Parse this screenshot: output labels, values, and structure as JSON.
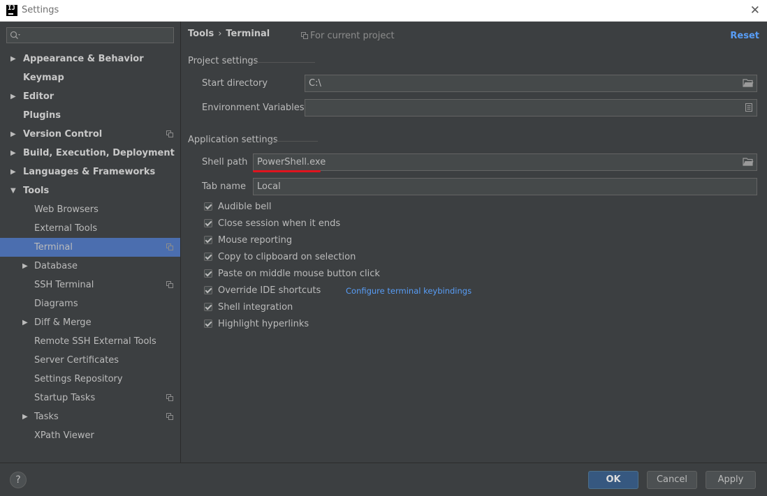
{
  "window": {
    "title": "Settings"
  },
  "sidebar": {
    "search_placeholder": "",
    "items": [
      {
        "label": "Appearance & Behavior",
        "level": 0,
        "expandable": true,
        "expanded": false,
        "badge": false
      },
      {
        "label": "Keymap",
        "level": 0,
        "expandable": false,
        "badge": false
      },
      {
        "label": "Editor",
        "level": 0,
        "expandable": true,
        "expanded": false,
        "badge": false
      },
      {
        "label": "Plugins",
        "level": 0,
        "expandable": false,
        "badge": false
      },
      {
        "label": "Version Control",
        "level": 0,
        "expandable": true,
        "expanded": false,
        "badge": true
      },
      {
        "label": "Build, Execution, Deployment",
        "level": 0,
        "expandable": true,
        "expanded": false,
        "badge": false
      },
      {
        "label": "Languages & Frameworks",
        "level": 0,
        "expandable": true,
        "expanded": false,
        "badge": false
      },
      {
        "label": "Tools",
        "level": 0,
        "expandable": true,
        "expanded": true,
        "badge": false
      },
      {
        "label": "Web Browsers",
        "level": 1,
        "expandable": false,
        "badge": false
      },
      {
        "label": "External Tools",
        "level": 1,
        "expandable": false,
        "badge": false
      },
      {
        "label": "Terminal",
        "level": 1,
        "expandable": false,
        "badge": true,
        "selected": true
      },
      {
        "label": "Database",
        "level": 1,
        "expandable": true,
        "expanded": false,
        "badge": false
      },
      {
        "label": "SSH Terminal",
        "level": 1,
        "expandable": false,
        "badge": true
      },
      {
        "label": "Diagrams",
        "level": 1,
        "expandable": false,
        "badge": false
      },
      {
        "label": "Diff & Merge",
        "level": 1,
        "expandable": true,
        "expanded": false,
        "badge": false
      },
      {
        "label": "Remote SSH External Tools",
        "level": 1,
        "expandable": false,
        "badge": false
      },
      {
        "label": "Server Certificates",
        "level": 1,
        "expandable": false,
        "badge": false
      },
      {
        "label": "Settings Repository",
        "level": 1,
        "expandable": false,
        "badge": false
      },
      {
        "label": "Startup Tasks",
        "level": 1,
        "expandable": false,
        "badge": true
      },
      {
        "label": "Tasks",
        "level": 1,
        "expandable": true,
        "expanded": false,
        "badge": true
      },
      {
        "label": "XPath Viewer",
        "level": 1,
        "expandable": false,
        "badge": false
      }
    ]
  },
  "header": {
    "breadcrumb": [
      "Tools",
      "Terminal"
    ],
    "breadcrumb_separator": "›",
    "scope": "For current project",
    "reset_label": "Reset"
  },
  "project_settings": {
    "title": "Project settings",
    "start_directory": {
      "label": "Start directory",
      "value": "C:\\"
    },
    "env_vars": {
      "label": "Environment Variables",
      "value": ""
    }
  },
  "app_settings": {
    "title": "Application settings",
    "shell_path": {
      "label": "Shell path",
      "value": "PowerShell.exe"
    },
    "tab_name": {
      "label": "Tab name",
      "value": "Local"
    },
    "checkboxes": [
      {
        "label": "Audible bell",
        "checked": true
      },
      {
        "label": "Close session when it ends",
        "checked": true
      },
      {
        "label": "Mouse reporting",
        "checked": true
      },
      {
        "label": "Copy to clipboard on selection",
        "checked": true
      },
      {
        "label": "Paste on middle mouse button click",
        "checked": true
      },
      {
        "label": "Override IDE shortcuts",
        "checked": true,
        "link": "Configure terminal keybindings"
      },
      {
        "label": "Shell integration",
        "checked": true
      },
      {
        "label": "Highlight hyperlinks",
        "checked": true
      }
    ]
  },
  "footer": {
    "help_label": "?",
    "ok_label": "OK",
    "cancel_label": "Cancel",
    "apply_label": "Apply"
  },
  "colors": {
    "background": "#3c3f41",
    "selection": "#4b6eaf",
    "link": "#589df6",
    "ok_button": "#365880",
    "annotation_underline": "#e0141e"
  }
}
